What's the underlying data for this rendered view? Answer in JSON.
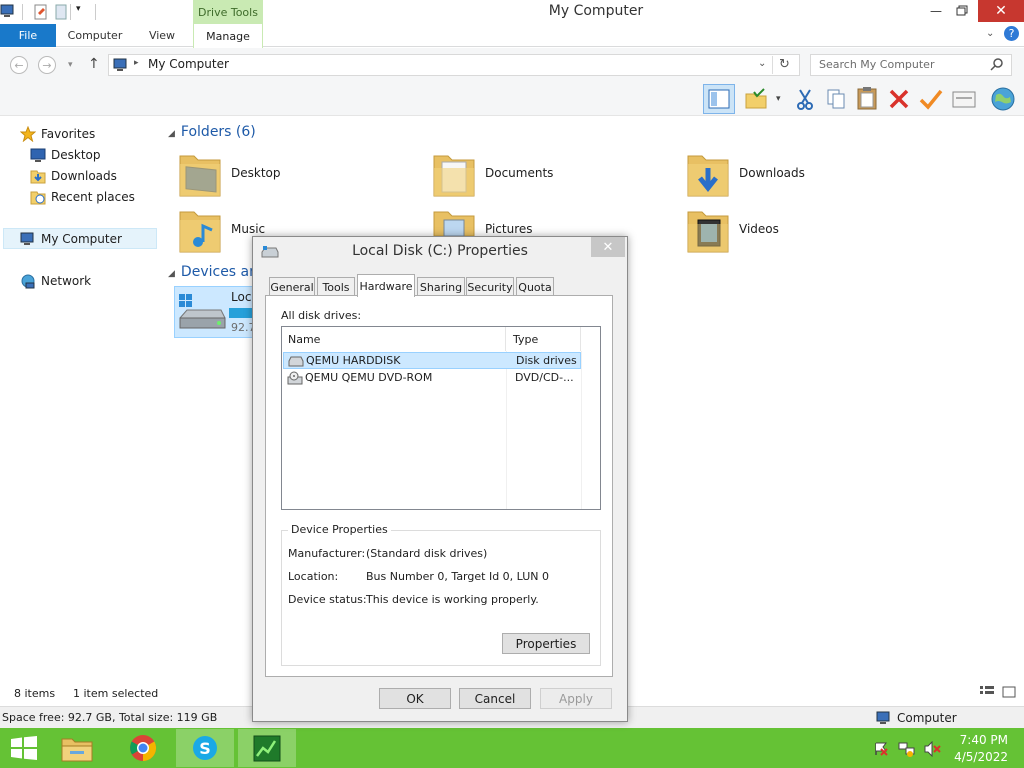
{
  "window": {
    "title": "My Computer"
  },
  "ribbon": {
    "context_group": "Drive Tools",
    "tabs": [
      "File",
      "Computer",
      "View",
      "Manage"
    ]
  },
  "address": {
    "path": "My Computer",
    "search_placeholder": "Search My Computer"
  },
  "nav": {
    "favorites": "Favorites",
    "desktop": "Desktop",
    "downloads": "Downloads",
    "recent": "Recent places",
    "mycomputer": "My Computer",
    "network": "Network"
  },
  "content": {
    "folders_header": "Folders (6)",
    "folders": [
      "Desktop",
      "Documents",
      "Downloads",
      "Music",
      "Pictures",
      "Videos"
    ],
    "devices_header": "Devices an",
    "drive_label": "Loc",
    "drive_free": "92.7"
  },
  "status": {
    "items": "8 items",
    "selected": "1 item selected",
    "space": "Space free: 92.7 GB, Total size: 119 GB",
    "computer": "Computer"
  },
  "dialog": {
    "title": "Local Disk (C:) Properties",
    "tabs": [
      "General",
      "Tools",
      "Hardware",
      "Sharing",
      "Security",
      "Quota"
    ],
    "all_disk_drives": "All disk drives:",
    "columns": {
      "name": "Name",
      "type": "Type"
    },
    "drives": [
      {
        "name": "QEMU HARDDISK",
        "type": "Disk drives"
      },
      {
        "name": "QEMU QEMU DVD-ROM",
        "type": "DVD/CD-..."
      }
    ],
    "device_properties": "Device Properties",
    "manufacturer_label": "Manufacturer:",
    "manufacturer": "(Standard disk drives)",
    "location_label": "Location:",
    "location": "Bus Number 0, Target Id 0, LUN 0",
    "status_label": "Device status:",
    "status": "This device is working properly.",
    "properties_button": "Properties",
    "ok": "OK",
    "cancel": "Cancel",
    "apply": "Apply"
  },
  "taskbar": {
    "time": "7:40 PM",
    "date": "4/5/2022"
  },
  "colors": {
    "taskbar": "#65c235",
    "file_tab": "#1979ca",
    "selection": "#cce8ff",
    "section_header": "#1e5aa8",
    "close_button": "#c7372f"
  }
}
